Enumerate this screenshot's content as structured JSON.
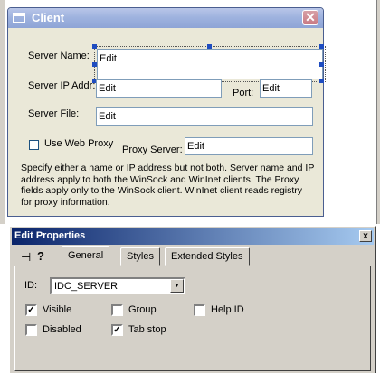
{
  "client_dialog": {
    "title": "Client",
    "close_glyph": "✕",
    "server_name_label": "Server Name:",
    "server_name_value": "Edit",
    "server_ip_label": "Server IP Addr:",
    "server_ip_value": "Edit",
    "port_label": "Port:",
    "port_value": "Edit",
    "server_file_label": "Server File:",
    "server_file_value": "Edit",
    "use_proxy_label": "Use Web Proxy",
    "proxy_server_label": "Proxy Server:",
    "proxy_server_value": "Edit",
    "help_text": "Specify either a name or IP address but not both. Server name and IP address apply to both the WinSock and WinInet clients. The Proxy fields apply only to the WinSock client. WinInet client reads registry for proxy information."
  },
  "properties": {
    "title": "Edit Properties",
    "close_glyph": "x",
    "pin_glyph": "⊣",
    "help_glyph": "?",
    "tabs": [
      {
        "label": "General",
        "active": true
      },
      {
        "label": "Styles",
        "active": false
      },
      {
        "label": "Extended Styles",
        "active": false
      }
    ],
    "id_label": "ID:",
    "id_value": "IDC_SERVER",
    "combo_arrow": "▼",
    "check_glyph": "✓",
    "checkboxes": {
      "visible": {
        "label": "Visible",
        "checked": true
      },
      "group": {
        "label": "Group",
        "checked": false
      },
      "help_id": {
        "label": "Help ID",
        "checked": false
      },
      "disabled": {
        "label": "Disabled",
        "checked": false
      },
      "tab_stop": {
        "label": "Tab stop",
        "checked": true
      }
    }
  },
  "colors": {
    "client_titlebar": "#9fb3df",
    "props_titlebar": "#0a246a",
    "selection_handle": "#1e4cc0"
  }
}
